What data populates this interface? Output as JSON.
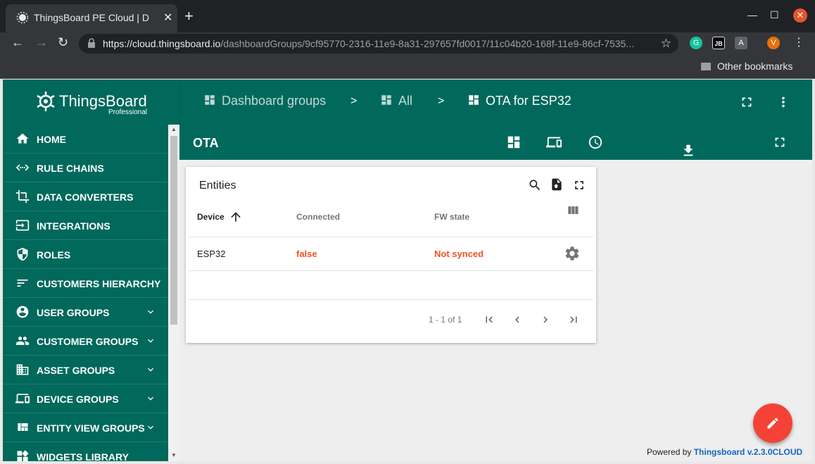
{
  "browser": {
    "tab_title": "ThingsBoard PE Cloud | D",
    "url_host": "https://cloud.thingsboard.io",
    "url_path": "/dashboardGroups/9cf95770-2316-11e9-8a31-297657fd0017/11c04b20-168f-11e9-86cf-7535...",
    "bookmark": "Other bookmarks",
    "profile_initial": "V",
    "colors": {
      "frame": "#202124",
      "toolbar": "#35363a",
      "close": "#e9542b"
    }
  },
  "brand": {
    "name": "ThingsBoard",
    "edition": "Professional",
    "color": "#00695c"
  },
  "sidebar": {
    "items": [
      {
        "label": "HOME",
        "icon": "home-icon",
        "expandable": false
      },
      {
        "label": "RULE CHAINS",
        "icon": "code-arrows-icon",
        "expandable": false
      },
      {
        "label": "DATA CONVERTERS",
        "icon": "crop-icon",
        "expandable": false
      },
      {
        "label": "INTEGRATIONS",
        "icon": "input-icon",
        "expandable": false
      },
      {
        "label": "ROLES",
        "icon": "shield-icon",
        "expandable": false
      },
      {
        "label": "CUSTOMERS HIERARCHY",
        "icon": "sort-lines-icon",
        "expandable": false
      },
      {
        "label": "USER GROUPS",
        "icon": "account-circle-icon",
        "expandable": true
      },
      {
        "label": "CUSTOMER GROUPS",
        "icon": "people-icon",
        "expandable": true
      },
      {
        "label": "ASSET GROUPS",
        "icon": "domain-icon",
        "expandable": true
      },
      {
        "label": "DEVICE GROUPS",
        "icon": "devices-icon",
        "expandable": true
      },
      {
        "label": "ENTITY VIEW GROUPS",
        "icon": "view-quilt-icon",
        "expandable": true
      },
      {
        "label": "WIDGETS LIBRARY",
        "icon": "widgets-icon",
        "expandable": false
      }
    ]
  },
  "breadcrumb": {
    "items": [
      "Dashboard groups",
      "All",
      "OTA for ESP32"
    ],
    "separator": ">"
  },
  "dashboard": {
    "title": "OTA"
  },
  "widget": {
    "title": "Entities",
    "columns": [
      "Device",
      "Connected",
      "FW state"
    ],
    "rows": [
      {
        "device": "ESP32",
        "connected": "false",
        "fw_state": "Not synced"
      }
    ],
    "pager": "1 - 1 of 1",
    "alert_color": "#f4511e"
  },
  "footer": {
    "powered_prefix": "Powered by",
    "link": "Thingsboard v.2.3.0CLOUD"
  }
}
